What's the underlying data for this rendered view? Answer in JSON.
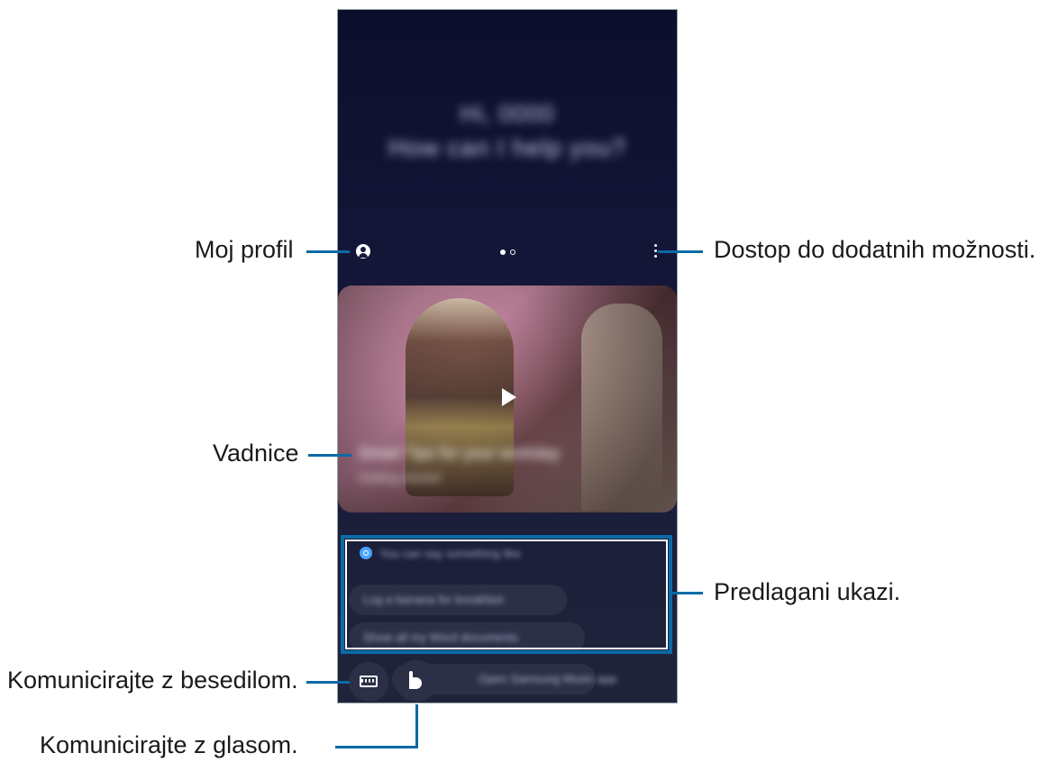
{
  "callouts": {
    "profile": "Moj profil",
    "more_options": "Dostop do dodatnih možnosti.",
    "tutorials": "Vadnice",
    "suggested_commands": "Predlagani ukazi.",
    "text_communication": "Komunicirajte z besedilom.",
    "voice_communication": "Komunicirajte z glasom."
  },
  "screen": {
    "greeting_line1": "Hi, 0000",
    "greeting_line2": "How can I help you?",
    "tutorial_title": "Smart Tips for your workday",
    "tutorial_subtitle": "Getting started",
    "suggest_header": "You can say something like",
    "suggestions": [
      "Log a banana for breakfast",
      "Show all my Word documents",
      "Open Samsung Music app"
    ]
  },
  "colors": {
    "accent": "#0a6aa6",
    "screen_bg": "#15183a"
  }
}
